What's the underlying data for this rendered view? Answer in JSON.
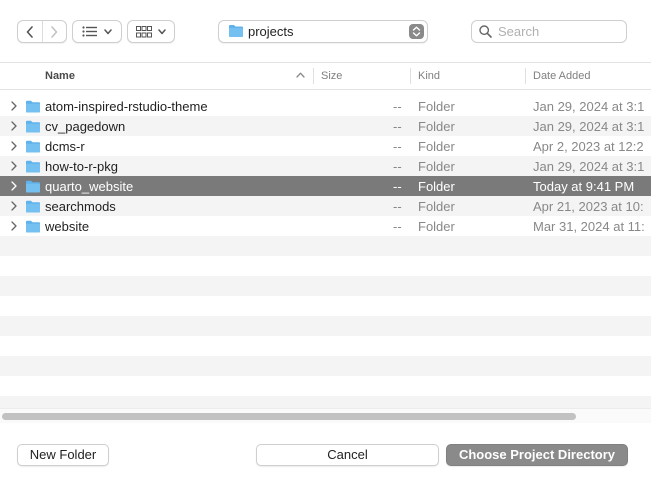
{
  "toolbar": {
    "back_icon": "chevron-left-icon",
    "forward_icon": "chevron-right-icon",
    "list_view_icon": "list-icon",
    "grid_view_icon": "grid-icon",
    "path_label": "projects",
    "search": {
      "placeholder": "Search",
      "value": ""
    }
  },
  "columns": {
    "name": "Name",
    "size": "Size",
    "kind": "Kind",
    "date": "Date Added"
  },
  "rows": [
    {
      "name": "atom-inspired-rstudio-theme",
      "size": "--",
      "kind": "Folder",
      "date": "Jan 29, 2024 at 3:1"
    },
    {
      "name": "cv_pagedown",
      "size": "--",
      "kind": "Folder",
      "date": "Jan 29, 2024 at 3:1"
    },
    {
      "name": "dcms-r",
      "size": "--",
      "kind": "Folder",
      "date": "Apr 2, 2023 at 12:2"
    },
    {
      "name": "how-to-r-pkg",
      "size": "--",
      "kind": "Folder",
      "date": "Jan 29, 2024 at 3:1"
    },
    {
      "name": "quarto_website",
      "size": "--",
      "kind": "Folder",
      "date": "Today at 9:41 PM"
    },
    {
      "name": "searchmods",
      "size": "--",
      "kind": "Folder",
      "date": "Apr 21, 2023 at 10:"
    },
    {
      "name": "website",
      "size": "--",
      "kind": "Folder",
      "date": "Mar 31, 2024 at 11:"
    }
  ],
  "selected_row": "quarto_website",
  "footer": {
    "new_folder": "New Folder",
    "cancel": "Cancel",
    "choose": "Choose Project Directory"
  },
  "colors": {
    "folder": "#5fb3ea",
    "selection": "#7a7a7a",
    "default_button": "#8a8a8a"
  }
}
